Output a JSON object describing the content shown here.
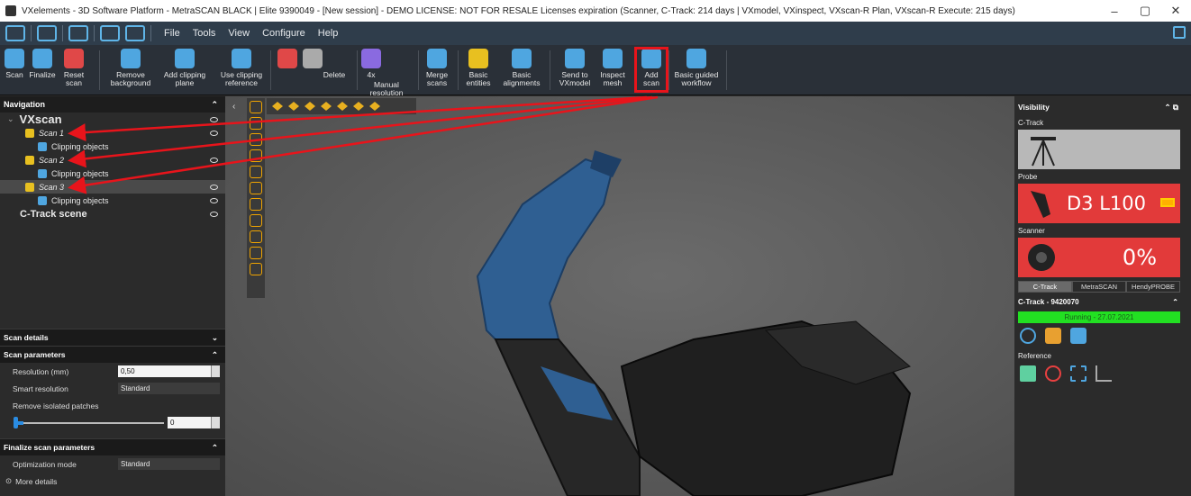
{
  "titlebar": {
    "title": "VXelements - 3D Software Platform - MetraSCAN BLACK | Elite 9390049 - [New session] - DEMO LICENSE: NOT FOR RESALE Licenses expiration (Scanner, C-Track: 214 days | VXmodel, VXinspect, VXscan-R Plan, VXscan-R Execute: 215 days)",
    "minimize": "–",
    "maximize": "▢",
    "close": "✕"
  },
  "menu": [
    "File",
    "Tools",
    "View",
    "Configure",
    "Help"
  ],
  "ribbon": {
    "buttons": [
      {
        "label": "Scan",
        "color": "#4fa6e0"
      },
      {
        "label": "Finalize",
        "color": "#4fa6e0"
      },
      {
        "label": "Reset\nscan",
        "color": "#e04848"
      },
      {
        "label": "Remove\nbackground",
        "color": "#4fa6e0"
      },
      {
        "label": "Add clipping\nplane",
        "color": "#4fa6e0"
      },
      {
        "label": "Use clipping\nreference",
        "color": "#4fa6e0"
      },
      {
        "label": "",
        "color": "#e04848"
      },
      {
        "label": "",
        "color": "#aaaaaa"
      },
      {
        "label": "Delete",
        "color": "#aaaaaa"
      },
      {
        "label": "4x",
        "color": "#8a6ae0"
      },
      {
        "label": "Manual resolution",
        "color": "#4fa6e0"
      },
      {
        "label": "Merge\nscans",
        "color": "#4fa6e0"
      },
      {
        "label": "Basic\nentities",
        "color": "#e8c020"
      },
      {
        "label": "Basic\nalignments",
        "color": "#4fa6e0"
      },
      {
        "label": "Send to\nVXmodel",
        "color": "#4fa6e0"
      },
      {
        "label": "Inspect\nmesh",
        "color": "#4fa6e0"
      },
      {
        "label": "Add\nscan",
        "color": "#4fa6e0"
      },
      {
        "label": "Basic guided\nworkflow",
        "color": "#4fa6e0"
      }
    ]
  },
  "navigation": {
    "title": "Navigation",
    "root": "VXscan",
    "items": [
      {
        "label": "Scan 1",
        "child": "Clipping objects"
      },
      {
        "label": "Scan 2",
        "child": "Clipping objects"
      },
      {
        "label": "Scan 3",
        "child": "Clipping objects"
      }
    ],
    "scene": "C-Track scene"
  },
  "scan_details": {
    "title": "Scan details",
    "params_title": "Scan parameters",
    "resolution_label": "Resolution (mm)",
    "resolution_value": "0,50",
    "smart_label": "Smart resolution",
    "smart_value": "Standard",
    "patches_label": "Remove isolated patches",
    "patches_value": "0",
    "finalize_title": "Finalize scan parameters",
    "optimization_label": "Optimization mode",
    "optimization_value": "Standard",
    "more_details": "More details"
  },
  "visibility": {
    "title": "Visibility",
    "ctrack_label": "C-Track",
    "probe_label": "Probe",
    "probe_text": "D3 L100",
    "scanner_label": "Scanner",
    "scanner_text": "0%",
    "tabs": [
      "C-Track",
      "MetraSCAN",
      "HendyPROBE"
    ],
    "device_title": "C-Track - 9420070",
    "status": "Running - 27.07.2021",
    "reference_label": "Reference"
  },
  "colors": {
    "accent": "#4fa6e0",
    "highlight": "#e8141b",
    "status_ok": "#22e022",
    "alert": "#e23a3a"
  }
}
